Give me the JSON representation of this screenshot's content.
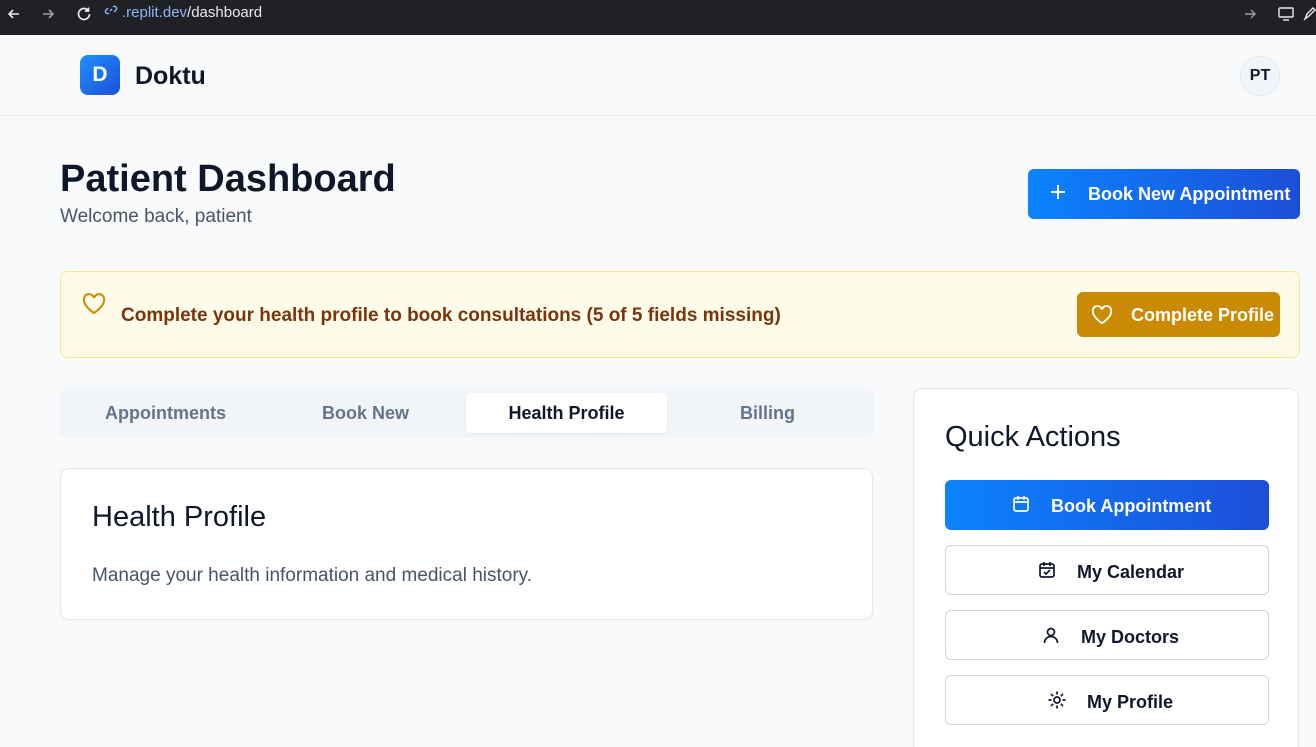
{
  "browser": {
    "url_domain": ".replit.dev",
    "url_path": "/dashboard"
  },
  "header": {
    "logo_letter": "D",
    "app_name": "Doktu",
    "avatar_initials": "PT"
  },
  "page": {
    "title": "Patient Dashboard",
    "subtitle": "Welcome back, patient",
    "primary_button": "Book New Appointment"
  },
  "alert": {
    "message": "Complete your health profile to book consultations (5 of 5 fields missing)",
    "button": "Complete Profile"
  },
  "tabs": [
    {
      "label": "Appointments",
      "active": false
    },
    {
      "label": "Book New",
      "active": false
    },
    {
      "label": "Health Profile",
      "active": true
    },
    {
      "label": "Billing",
      "active": false
    }
  ],
  "health_card": {
    "title": "Health Profile",
    "description": "Manage your health information and medical history."
  },
  "quick_actions": {
    "title": "Quick Actions",
    "items": [
      {
        "label": "Book Appointment",
        "icon": "calendar-icon"
      },
      {
        "label": "My Calendar",
        "icon": "calendar-check-icon"
      },
      {
        "label": "My Doctors",
        "icon": "user-icon"
      },
      {
        "label": "My Profile",
        "icon": "gear-icon"
      }
    ]
  },
  "colors": {
    "primary": "#0b83ff",
    "alert_bg": "#fefce8",
    "alert_button": "#ca8a04"
  }
}
